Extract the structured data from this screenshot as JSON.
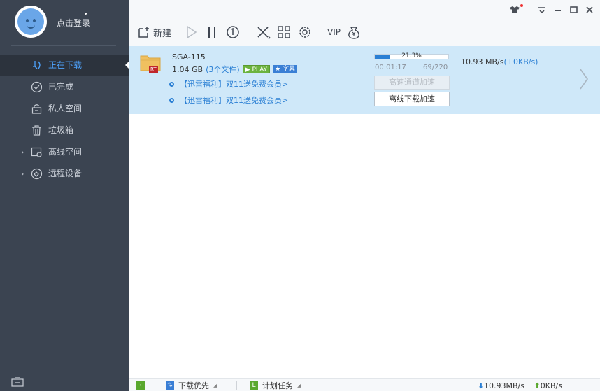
{
  "profile": {
    "login_label": "点击登录"
  },
  "sidebar": {
    "items": [
      {
        "label": "正在下载",
        "icon": "download-icon"
      },
      {
        "label": "已完成",
        "icon": "check-circle-icon"
      },
      {
        "label": "私人空间",
        "icon": "lock-icon"
      },
      {
        "label": "垃圾箱",
        "icon": "trash-icon"
      },
      {
        "label": "离线空间",
        "icon": "cloud-folder-icon"
      },
      {
        "label": "远程设备",
        "icon": "remote-device-icon"
      }
    ]
  },
  "toolbar": {
    "new_label": "新建",
    "vip_label": "VIP"
  },
  "task": {
    "name": "SGA-115",
    "size": "1.04 GB",
    "file_count": "(3个文件)",
    "play_tag": "PLAY",
    "subtitle_tag": "字幕",
    "progress_text": "21.3%",
    "progress": 0.213,
    "elapsed": "00:01:17",
    "pieces": "69/220",
    "speed": "10.93 MB/s",
    "upload_speed": "(+0KB/s)",
    "promo1": "【迅雷福利】双11送免费会员>",
    "promo2": "【迅雷福利】双11送免费会员>",
    "accel_label": "高速通道加速",
    "offline_label": "离线下载加速",
    "folder_badge": "RT"
  },
  "statusbar": {
    "priority_label": "下载优先",
    "schedule_label": "计划任务",
    "download_speed": "10.93MB/s",
    "upload_speed": "0KB/s"
  }
}
